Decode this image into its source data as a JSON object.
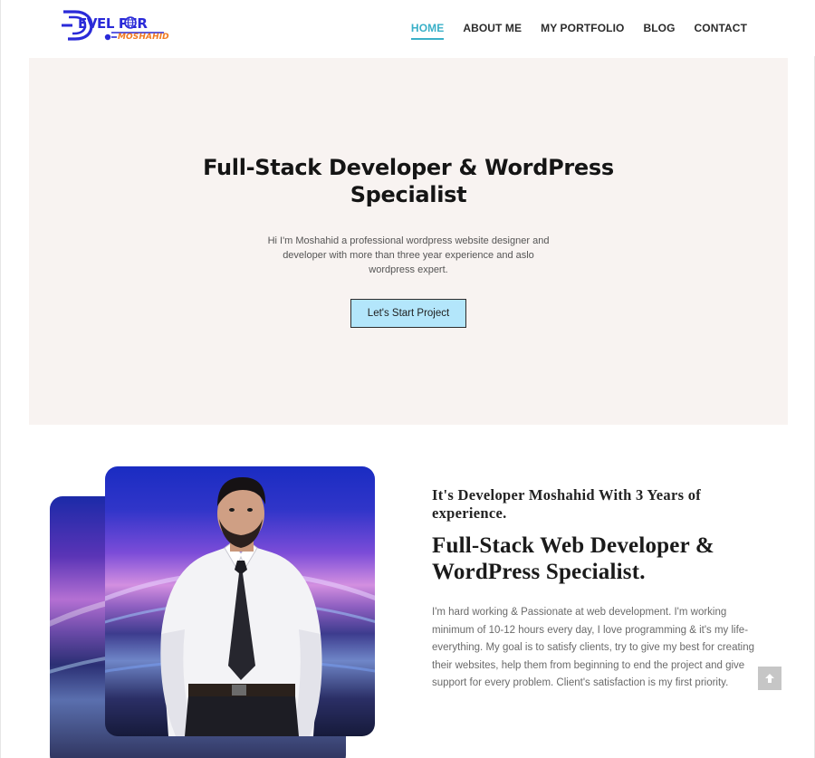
{
  "header": {
    "logo_word": "EVEL PER",
    "logo_sub": "MOSHAHID",
    "nav": [
      {
        "label": "HOME"
      },
      {
        "label": "ABOUT ME"
      },
      {
        "label": "MY PORTFOLIO"
      },
      {
        "label": "BLOG"
      },
      {
        "label": "CONTACT"
      }
    ],
    "active_nav": "HOME"
  },
  "hero": {
    "title": "Full-Stack Developer & WordPress Specialist",
    "text": "Hi I'm Moshahid a professional wordpress website designer and developer with more than three year experience and aslo wordpress expert.",
    "button_label": "Let's Start Project"
  },
  "about": {
    "intro": "It's Developer Moshahid With 3 Years of experience.",
    "title": "Full-Stack Web Developer & WordPress Specialist.",
    "text": "I'm hard working & Passionate at web development. I'm working minimum of 10-12 hours every day, I love programming & it's my life-everything. My goal is to satisfy clients, try to give my best for creating their websites, help them from beginning to end the project and give support for every problem. Client's satisfaction is my first priority."
  },
  "icons": {
    "scroll_top": "arrow-up-icon",
    "logo_globe": "globe-icon"
  },
  "colors": {
    "accent": "#3ab0c8",
    "brand_blue": "#2a2ad8",
    "brand_orange": "#f07a22",
    "hero_bg": "#f8f3f1",
    "button_bg": "#b3e6fb"
  }
}
